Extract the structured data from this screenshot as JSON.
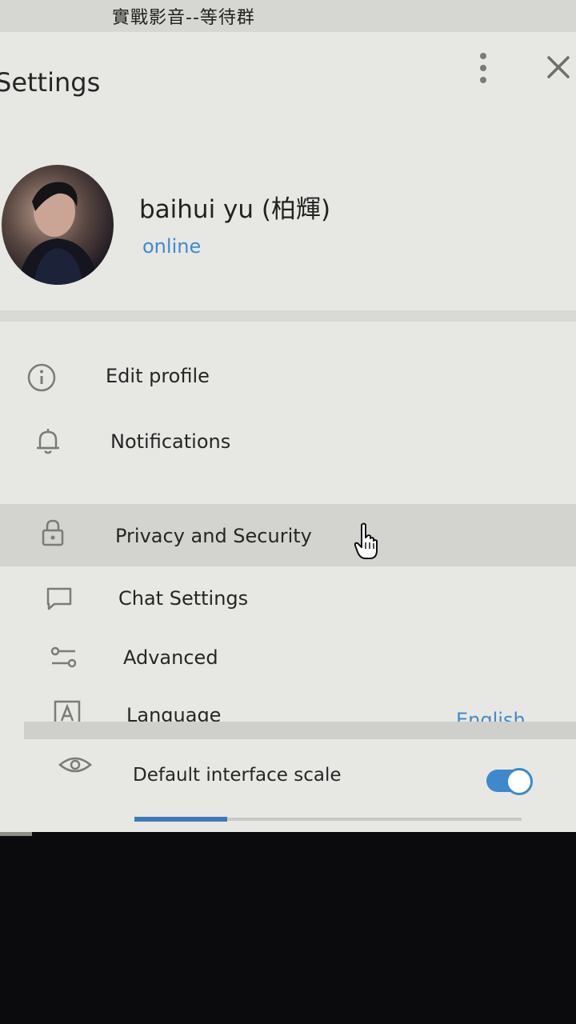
{
  "background": {
    "window_title": "實戰影音--等待群"
  },
  "dialog": {
    "title": "Settings",
    "more_icon": "more-vertical-icon",
    "close_icon": "close-icon"
  },
  "profile": {
    "name": "baihui yu (柏輝)",
    "status": "online"
  },
  "menu": {
    "items": [
      {
        "label": "Edit profile",
        "icon": "info-icon"
      },
      {
        "label": "Notifications",
        "icon": "bell-icon"
      },
      {
        "label": "Privacy and Security",
        "icon": "lock-icon"
      },
      {
        "label": "Chat Settings",
        "icon": "chat-bubble-icon"
      },
      {
        "label": "Advanced",
        "icon": "sliders-icon"
      },
      {
        "label": "Language",
        "icon": "language-icon",
        "value": "English"
      }
    ]
  },
  "scale": {
    "label": "Default interface scale",
    "icon": "eye-icon",
    "toggle_on": true,
    "slider_fraction": 0.24
  },
  "colors": {
    "accent": "#3d8ccf",
    "panel": "#e7e7e3",
    "hover_row": "#d3d3cf"
  }
}
